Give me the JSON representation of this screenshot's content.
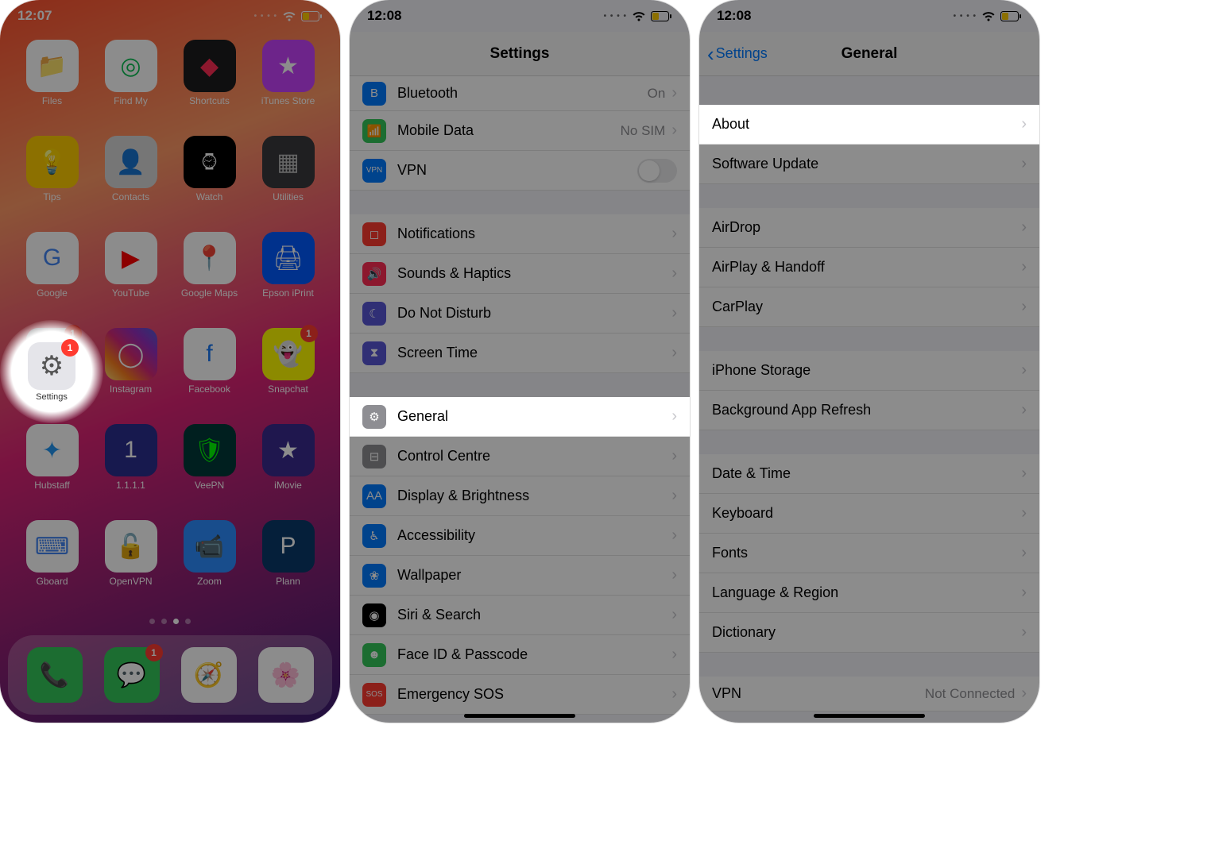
{
  "panel1": {
    "time": "12:07",
    "apps": [
      {
        "label": "Files",
        "bg": "#ffffff",
        "emoji": "📁",
        "fg": "#4aa3ff"
      },
      {
        "label": "Find My",
        "bg": "#ffffff",
        "emoji": "◎",
        "fg": "#0abf53"
      },
      {
        "label": "Shortcuts",
        "bg": "#1c1c1e",
        "emoji": "◆",
        "fg": "#ff2d55"
      },
      {
        "label": "iTunes Store",
        "bg": "#c643fc",
        "emoji": "★",
        "fg": "#fff"
      },
      {
        "label": "Tips",
        "bg": "#ffcc00",
        "emoji": "💡",
        "fg": "#fff"
      },
      {
        "label": "Contacts",
        "bg": "#d8d8d8",
        "emoji": "👤",
        "fg": "#7a7a7a"
      },
      {
        "label": "Watch",
        "bg": "#000000",
        "emoji": "⌚︎",
        "fg": "#fff"
      },
      {
        "label": "Utilities",
        "bg": "#3a3a3c",
        "emoji": "▦",
        "fg": "#bbb"
      },
      {
        "label": "Google",
        "bg": "#ffffff",
        "emoji": "G",
        "fg": "#4285f4"
      },
      {
        "label": "YouTube",
        "bg": "#ffffff",
        "emoji": "▶",
        "fg": "#ff0000"
      },
      {
        "label": "Google Maps",
        "bg": "#ffffff",
        "emoji": "📍",
        "fg": "#ea4335"
      },
      {
        "label": "Epson iPrint",
        "bg": "#005aff",
        "emoji": "🖨",
        "fg": "#fff"
      },
      {
        "label": "Settings",
        "bg": "#e5e5ea",
        "emoji": "⚙︎",
        "fg": "#6e6e73",
        "badge": "1"
      },
      {
        "label": "Instagram",
        "bg": "linear",
        "emoji": "◯",
        "fg": "#fff"
      },
      {
        "label": "Facebook",
        "bg": "#ffffff",
        "emoji": "f",
        "fg": "#1877f2"
      },
      {
        "label": "Snapchat",
        "bg": "#fffc00",
        "emoji": "👻",
        "fg": "#000",
        "badge": "1"
      },
      {
        "label": "Hubstaff",
        "bg": "#ffffff",
        "emoji": "✦",
        "fg": "#2196f3"
      },
      {
        "label": "1.1.1.1",
        "bg": "#2a2f8f",
        "emoji": "1",
        "fg": "#fff"
      },
      {
        "label": "VeePN",
        "bg": "#003a3a",
        "emoji": "🛡",
        "fg": "#0f0"
      },
      {
        "label": "iMovie",
        "bg": "#3a2a8f",
        "emoji": "★",
        "fg": "#fff"
      },
      {
        "label": "Gboard",
        "bg": "#ffffff",
        "emoji": "⌨",
        "fg": "#4285f4"
      },
      {
        "label": "OpenVPN",
        "bg": "#ffffff",
        "emoji": "🔓",
        "fg": "#ff9500"
      },
      {
        "label": "Zoom",
        "bg": "#2d8cff",
        "emoji": "📹",
        "fg": "#fff"
      },
      {
        "label": "Plann",
        "bg": "#0a3a6b",
        "emoji": "P",
        "fg": "#fff"
      }
    ],
    "dock": [
      {
        "label": "Phone",
        "bg": "#34c759",
        "emoji": "📞"
      },
      {
        "label": "Messages",
        "bg": "#34c759",
        "emoji": "💬",
        "badge": "1"
      },
      {
        "label": "Safari",
        "bg": "#ffffff",
        "emoji": "🧭"
      },
      {
        "label": "Photos",
        "bg": "#ffffff",
        "emoji": "🌸"
      }
    ],
    "spotlight": {
      "label": "Settings",
      "badge": "1"
    }
  },
  "panel2": {
    "time": "12:08",
    "title": "Settings",
    "rows": [
      {
        "icon": "bg-blue",
        "glyph": "B",
        "label": "Bluetooth",
        "detail": "On",
        "chevron": true,
        "partial": true
      },
      {
        "icon": "bg-green",
        "glyph": "📶",
        "label": "Mobile Data",
        "detail": "No SIM",
        "chevron": true
      },
      {
        "icon": "bg-blue",
        "glyph": "VPN",
        "label": "VPN",
        "toggle": true
      },
      {
        "gap": true
      },
      {
        "icon": "bg-red",
        "glyph": "◻︎",
        "label": "Notifications",
        "chevron": true
      },
      {
        "icon": "bg-pink",
        "glyph": "🔊",
        "label": "Sounds & Haptics",
        "chevron": true
      },
      {
        "icon": "bg-purple",
        "glyph": "☾",
        "label": "Do Not Disturb",
        "chevron": true
      },
      {
        "icon": "bg-purple",
        "glyph": "⧗",
        "label": "Screen Time",
        "chevron": true
      },
      {
        "gap": true
      },
      {
        "icon": "bg-grey",
        "glyph": "⚙︎",
        "label": "General",
        "chevron": true,
        "highlight": true
      },
      {
        "icon": "bg-grey",
        "glyph": "⊟",
        "label": "Control Centre",
        "chevron": true
      },
      {
        "icon": "bg-blue",
        "glyph": "AA",
        "label": "Display & Brightness",
        "chevron": true
      },
      {
        "icon": "bg-blue",
        "glyph": "♿︎",
        "label": "Accessibility",
        "chevron": true
      },
      {
        "icon": "bg-blue",
        "glyph": "❀",
        "label": "Wallpaper",
        "chevron": true
      },
      {
        "icon": "bg-black",
        "glyph": "◉",
        "label": "Siri & Search",
        "chevron": true
      },
      {
        "icon": "bg-green",
        "glyph": "☻",
        "label": "Face ID & Passcode",
        "chevron": true
      },
      {
        "icon": "bg-red",
        "glyph": "SOS",
        "label": "Emergency SOS",
        "chevron": true
      }
    ]
  },
  "panel3": {
    "time": "12:08",
    "back": "Settings",
    "title": "General",
    "rows": [
      {
        "gap": true,
        "big": true
      },
      {
        "label": "About",
        "chevron": true,
        "highlight": true
      },
      {
        "label": "Software Update",
        "chevron": true
      },
      {
        "gap": true
      },
      {
        "label": "AirDrop",
        "chevron": true
      },
      {
        "label": "AirPlay & Handoff",
        "chevron": true
      },
      {
        "label": "CarPlay",
        "chevron": true
      },
      {
        "gap": true
      },
      {
        "label": "iPhone Storage",
        "chevron": true
      },
      {
        "label": "Background App Refresh",
        "chevron": true
      },
      {
        "gap": true
      },
      {
        "label": "Date & Time",
        "chevron": true
      },
      {
        "label": "Keyboard",
        "chevron": true
      },
      {
        "label": "Fonts",
        "chevron": true
      },
      {
        "label": "Language & Region",
        "chevron": true
      },
      {
        "label": "Dictionary",
        "chevron": true
      },
      {
        "gap": true
      },
      {
        "label": "VPN",
        "detail": "Not Connected",
        "chevron": true,
        "partial": true
      }
    ]
  }
}
